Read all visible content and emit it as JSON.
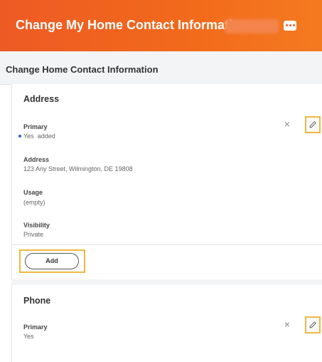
{
  "header": {
    "title": "Change My Home Contact Information",
    "more_icon": "ellipsis-icon",
    "background": "#f26a1b"
  },
  "subheader": {
    "title": "Change Home Contact Information"
  },
  "address": {
    "title": "Address",
    "primary_label": "Primary",
    "primary_value": "Yes",
    "primary_note": "added",
    "address_label": "Address",
    "address_value": "123 Any Street, Wilmington, DE 19808",
    "usage_label": "Usage",
    "usage_value": "(empty)",
    "visibility_label": "Visibility",
    "visibility_value": "Private",
    "add_label": "Add",
    "remove_icon": "close-icon",
    "edit_icon": "pencil-icon"
  },
  "phone": {
    "title": "Phone",
    "primary_label": "Primary",
    "primary_value": "Yes",
    "remove_icon": "close-icon",
    "edit_icon": "pencil-icon"
  },
  "colors": {
    "highlight": "#f0b841",
    "added_dot": "#1c6ed1"
  }
}
